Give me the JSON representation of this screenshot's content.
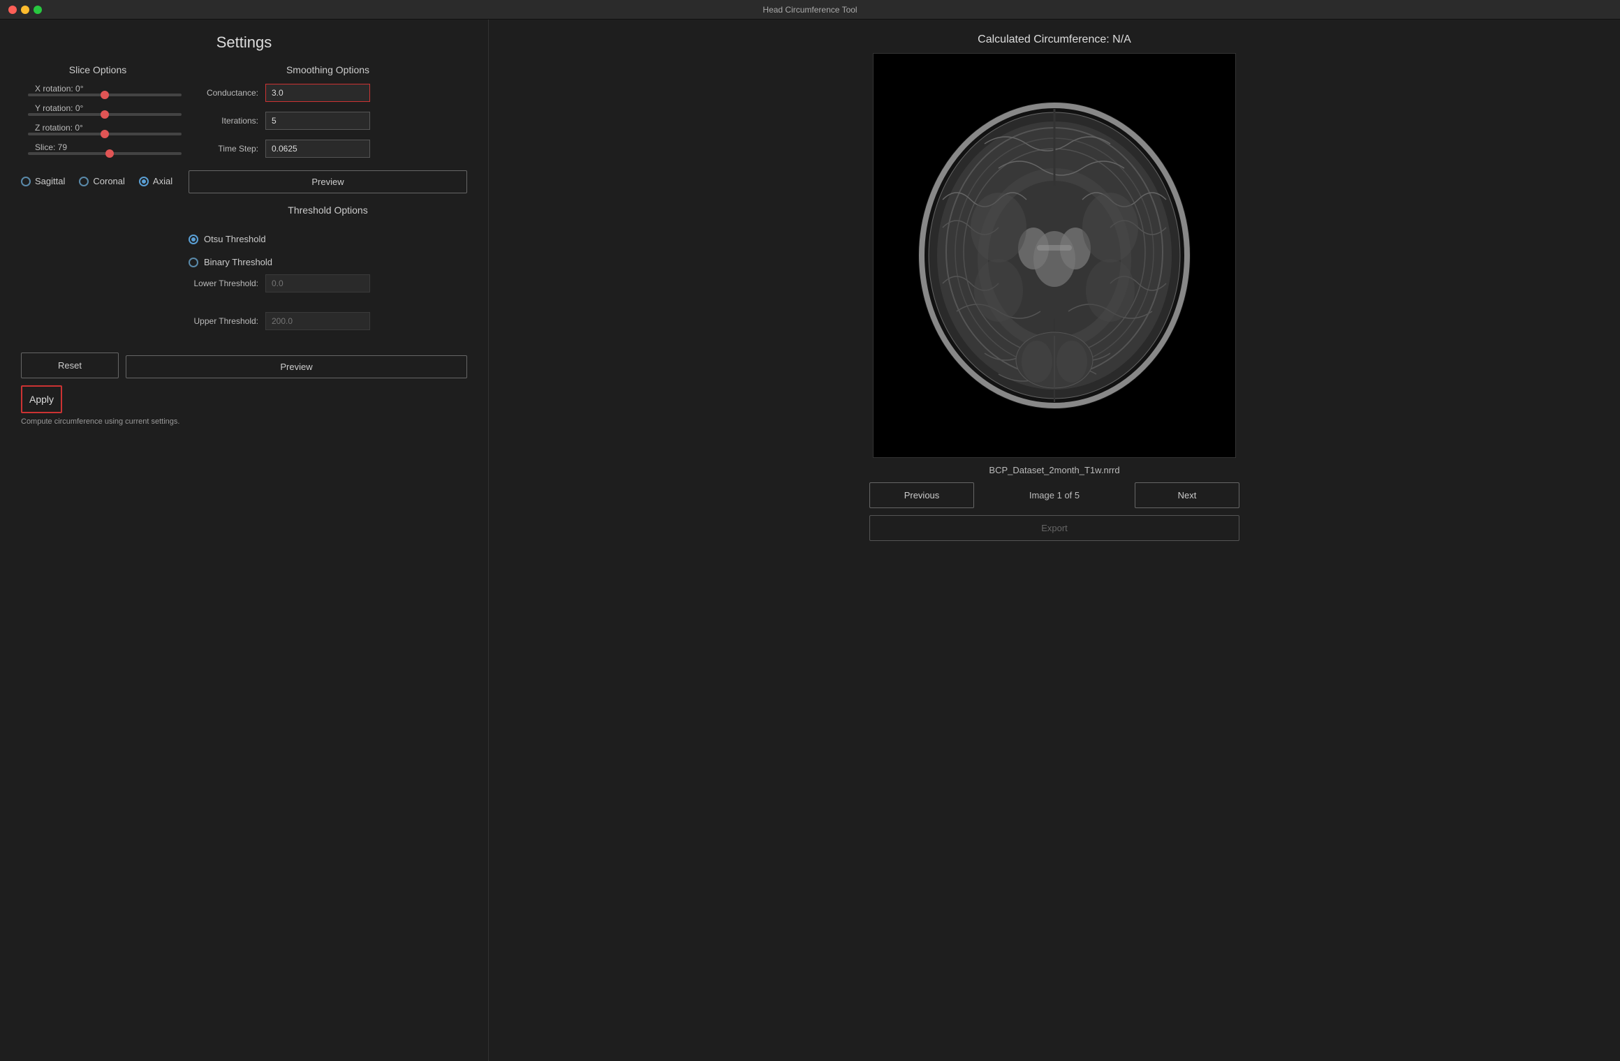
{
  "titlebar": {
    "title": "Head Circumference Tool"
  },
  "settings": {
    "title": "Settings"
  },
  "slice_options": {
    "title": "Slice Options",
    "sliders": [
      {
        "label": "X rotation: 0°",
        "value": 0,
        "position": 50
      },
      {
        "label": "Y rotation: 0°",
        "value": 0,
        "position": 50
      },
      {
        "label": "Z rotation: 0°",
        "value": 0,
        "position": 50
      },
      {
        "label": "Slice: 79",
        "value": 79,
        "position": 53
      }
    ]
  },
  "smoothing_options": {
    "title": "Smoothing Options",
    "fields": [
      {
        "label": "Conductance:",
        "value": "3.0",
        "placeholder": "3.0",
        "highlighted": true
      },
      {
        "label": "Iterations:",
        "value": "5",
        "placeholder": "5",
        "highlighted": false
      },
      {
        "label": "Time Step:",
        "value": "0.0625",
        "placeholder": "0.0625",
        "highlighted": false
      }
    ],
    "preview_label": "Preview"
  },
  "threshold_options": {
    "title": "Threshold Options",
    "options": [
      {
        "label": "Otsu Threshold",
        "selected": true
      },
      {
        "label": "Binary Threshold",
        "selected": false
      }
    ],
    "lower_threshold_label": "Lower Threshold:",
    "lower_threshold_value": "",
    "lower_threshold_placeholder": "0.0",
    "upper_threshold_label": "Upper Threshold:",
    "upper_threshold_value": "",
    "upper_threshold_placeholder": "200.0",
    "preview_label": "Preview"
  },
  "orientation": {
    "options": [
      {
        "label": "Sagittal",
        "selected": false
      },
      {
        "label": "Coronal",
        "selected": false
      },
      {
        "label": "Axial",
        "selected": true
      }
    ]
  },
  "buttons": {
    "reset": "Reset",
    "apply": "Apply",
    "status": "Compute circumference using current settings."
  },
  "right_panel": {
    "circumference_title": "Calculated Circumference: N/A",
    "dataset_label": "BCP_Dataset_2month_T1w.nrrd",
    "previous_label": "Previous",
    "next_label": "Next",
    "image_counter": "Image 1 of 5",
    "export_label": "Export"
  }
}
